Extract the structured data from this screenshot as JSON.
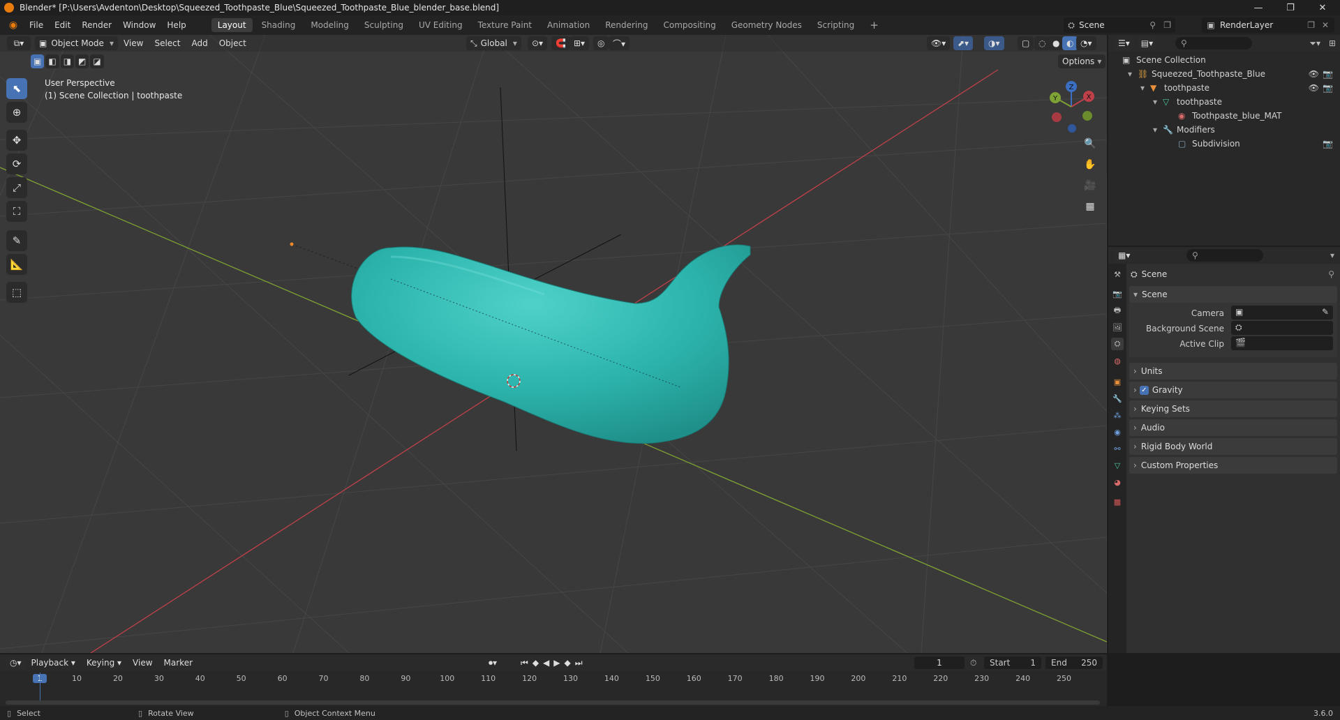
{
  "title_bar": {
    "title": "Blender* [P:\\Users\\Avdenton\\Desktop\\Squeezed_Toothpaste_Blue\\Squeezed_Toothpaste_Blue_blender_base.blend]",
    "minimize": "—",
    "maximize": "❐",
    "close": "✕"
  },
  "menus": [
    "File",
    "Edit",
    "Render",
    "Window",
    "Help"
  ],
  "workspaces": [
    "Layout",
    "Shading",
    "Modeling",
    "Sculpting",
    "UV Editing",
    "Texture Paint",
    "Animation",
    "Rendering",
    "Compositing",
    "Geometry Nodes",
    "Scripting"
  ],
  "active_workspace": "Layout",
  "add_workspace": "+",
  "scene_selector": {
    "value": "Scene"
  },
  "renderlayer_selector": {
    "value": "RenderLayer"
  },
  "viewport": {
    "mode": "Object Mode",
    "menus": [
      "View",
      "Select",
      "Add",
      "Object"
    ],
    "orientation": "Global",
    "options": "Options",
    "perspective_label": "User Perspective",
    "collection_label": "(1) Scene Collection | toothpaste",
    "gizmo_axes": {
      "x": "X",
      "y": "Y",
      "z": "Z"
    },
    "background_color": "#393939",
    "object_color": "#2fb8b0"
  },
  "outliner": {
    "search_placeholder": "",
    "rows": [
      {
        "label": "Scene Collection",
        "icon": "collection-icon"
      },
      {
        "label": "Squeezed_Toothpaste_Blue",
        "icon": "collection-icon"
      },
      {
        "label": "toothpaste",
        "icon": "object-icon"
      },
      {
        "label": "toothpaste",
        "icon": "mesh-data-icon"
      },
      {
        "label": "Toothpaste_blue_MAT",
        "icon": "material-icon"
      },
      {
        "label": "Modifiers",
        "icon": "wrench-icon"
      },
      {
        "label": "Subdivision",
        "icon": "modifier-icon"
      }
    ]
  },
  "properties": {
    "header": "Scene",
    "scene_panel": "Scene",
    "fields": [
      {
        "label": "Camera",
        "value": ""
      },
      {
        "label": "Background Scene",
        "value": ""
      },
      {
        "label": "Active Clip",
        "value": ""
      }
    ],
    "panels": [
      "Units",
      "Gravity",
      "Keying Sets",
      "Audio",
      "Rigid Body World",
      "Custom Properties"
    ],
    "gravity_checked": true
  },
  "timeline": {
    "menus": [
      "Playback",
      "Keying",
      "View",
      "Marker"
    ],
    "current_frame": "1",
    "start_label": "Start",
    "start_value": "1",
    "end_label": "End",
    "end_value": "250",
    "ticks": [
      "1",
      "10",
      "20",
      "30",
      "40",
      "50",
      "60",
      "70",
      "80",
      "90",
      "100",
      "110",
      "120",
      "130",
      "140",
      "150",
      "160",
      "170",
      "180",
      "190",
      "200",
      "210",
      "220",
      "230",
      "240",
      "250"
    ]
  },
  "status_bar": {
    "select": "Select",
    "rotate": "Rotate View",
    "context": "Object Context Menu",
    "version": "3.6.0"
  }
}
